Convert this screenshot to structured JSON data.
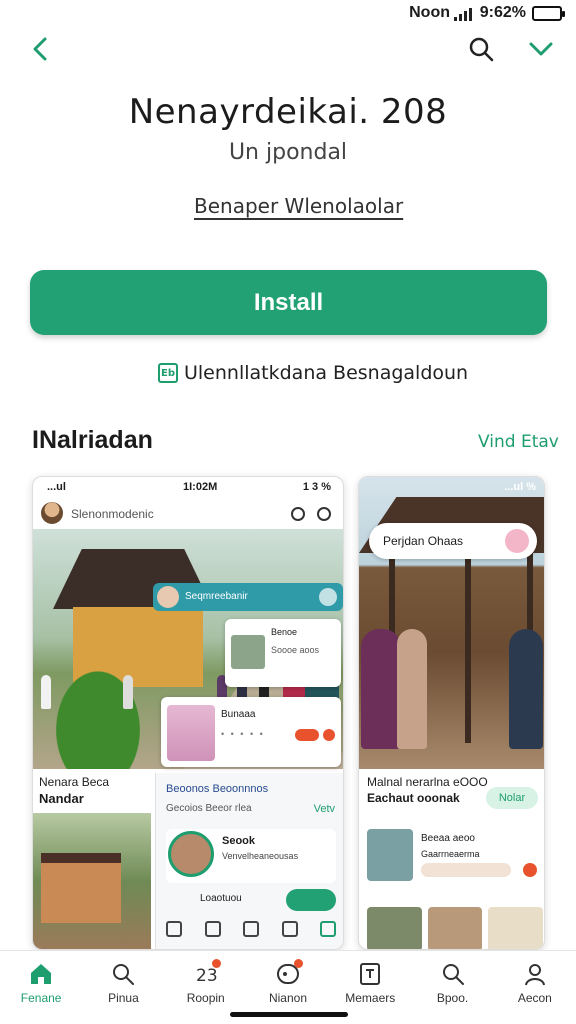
{
  "status_bar": {
    "carrier": "Noon",
    "battery_text": "9:62%"
  },
  "app": {
    "title": "Nenayrdeikai. 208",
    "subtitle": "Un jpondal",
    "developer": "Benaper Wlenolaolar"
  },
  "install_button": {
    "label": "Install"
  },
  "info_row": {
    "badge": "Eb",
    "text": "Ulennllatkdana Besnagaldoun"
  },
  "screenshots_section": {
    "title": "INalriadan",
    "link": "Vind Etav"
  },
  "screenshot1": {
    "status_left": "...ul",
    "status_time": "1I:02M",
    "status_right": "1 3 %",
    "header_title": "Slenonmodenic",
    "banner_text": "Seqmreebanir",
    "card_a_title": "Benoe",
    "card_a_sub": "Soooe aoos",
    "card_b_title": "Bunaaa",
    "card_b_dots": "• • • • •",
    "caption_1": "Nenara Beca",
    "caption_2": "Nandar",
    "list_title": "Beoonos Beoonnnos",
    "list_sub": "Gecoios Beeor rlea",
    "list_link": "Vetv",
    "row_title": "Seook",
    "row_sub": "Venvelheaneousas",
    "row2_text": "Loaotuou"
  },
  "screenshot2": {
    "status_right": "...ul %",
    "chip_text": "Perjdan Ohaas",
    "caption_1": "Malnal nerarlna eOOO",
    "caption_2": "Eachaut ooonak",
    "tag": "Nolar",
    "row_title": "Beeaa aeoo",
    "row_sub": "Gaarrneaerma"
  },
  "bottom_nav": [
    {
      "label": "Fenane",
      "icon": "home-icon",
      "active": true
    },
    {
      "label": "Pinua",
      "icon": "search-icon",
      "active": false
    },
    {
      "label": "Roopin",
      "icon": "apps-icon",
      "active": false,
      "badge": true
    },
    {
      "label": "Nianon",
      "icon": "notification-icon",
      "active": false,
      "badge": true
    },
    {
      "label": "Memaers",
      "icon": "grid-icon",
      "active": false
    },
    {
      "label": "Bpoo.",
      "icon": "search-icon",
      "active": false
    },
    {
      "label": "Aecon",
      "icon": "account-icon",
      "active": false
    }
  ],
  "colors": {
    "accent": "#21a174",
    "badge": "#e8532e"
  }
}
